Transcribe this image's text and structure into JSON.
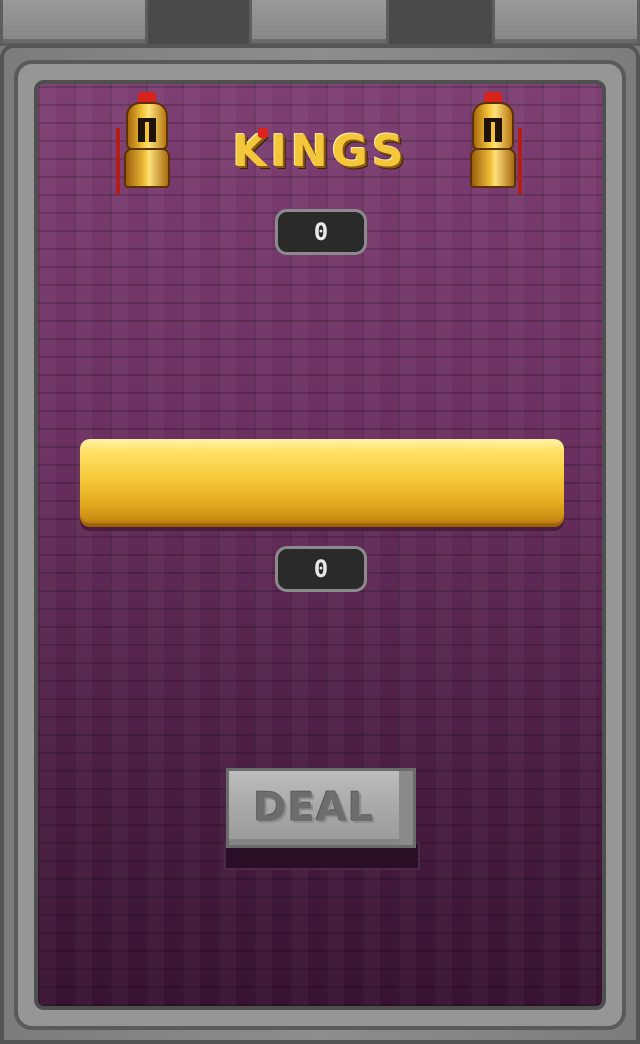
{
  "title": "KINGS",
  "scores": {
    "top": "0",
    "bottom": "0"
  },
  "deal_button": {
    "label": "DEAL"
  },
  "icons": {
    "left_knight": "golden-knight-icon",
    "right_knight": "golden-knight-icon"
  },
  "colors": {
    "wall": "#6a2f5f",
    "gold": "#f6c93a",
    "frame": "#8d8d8d",
    "score_bg": "#2a2a2a"
  }
}
